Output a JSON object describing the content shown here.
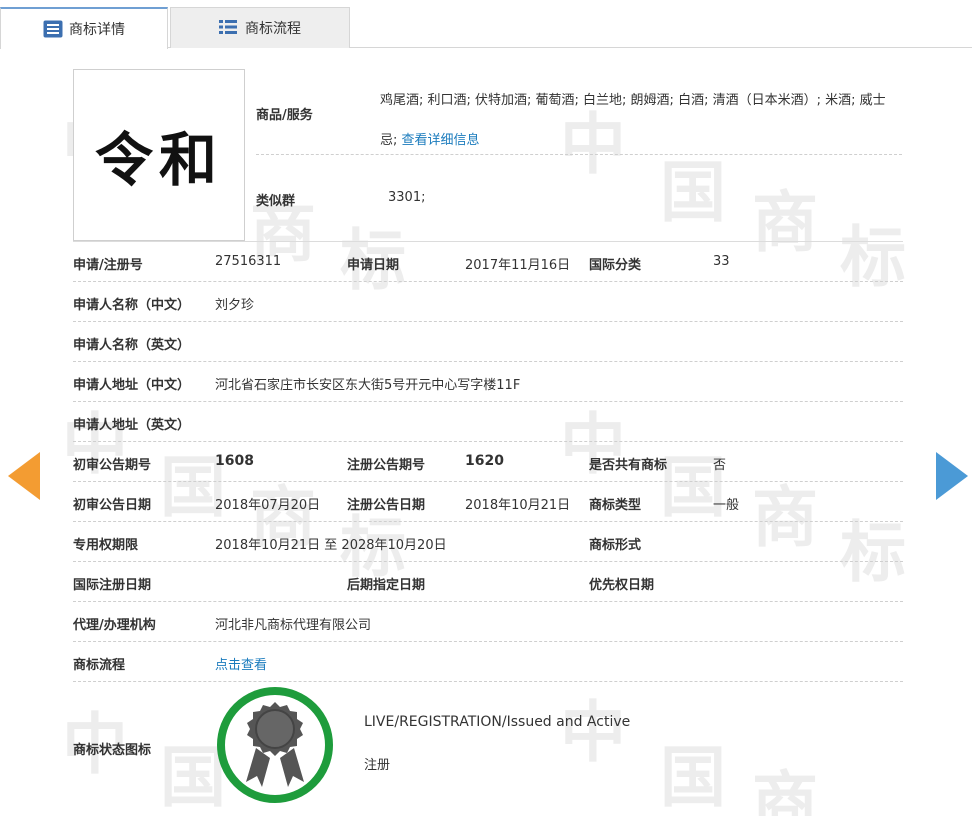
{
  "tabs": [
    {
      "label": "商标详情",
      "icon": "list-icon"
    },
    {
      "label": "商标流程",
      "icon": "grid-list-icon"
    }
  ],
  "watermark": {
    "chars": [
      "中",
      "国",
      "商",
      "标"
    ]
  },
  "logo": {
    "text": "令和"
  },
  "goods": {
    "label": "商品/服务",
    "text": "鸡尾酒; 利口酒; 伏特加酒; 葡萄酒; 白兰地; 朗姆酒; 白酒; 清酒（日本米酒）; 米酒; 威士忌;",
    "link": "查看详细信息"
  },
  "similar_group": {
    "label": "类似群",
    "value": "3301;"
  },
  "fields": {
    "reg_no": {
      "label": "申请/注册号",
      "value": "27516311"
    },
    "apply_date": {
      "label": "申请日期",
      "value": "2017年11月16日"
    },
    "intl_class": {
      "label": "国际分类",
      "value": "33"
    },
    "applicant_cn": {
      "label": "申请人名称（中文）",
      "value": "刘夕珍"
    },
    "applicant_en": {
      "label": "申请人名称（英文）",
      "value": ""
    },
    "address_cn": {
      "label": "申请人地址（中文）",
      "value": "河北省石家庄市长安区东大街5号开元中心写字楼11F"
    },
    "address_en": {
      "label": "申请人地址（英文）",
      "value": ""
    },
    "prelim_issue_no": {
      "label": "初审公告期号",
      "value": "1608"
    },
    "reg_issue_no": {
      "label": "注册公告期号",
      "value": "1620"
    },
    "shared": {
      "label": "是否共有商标",
      "value": "否"
    },
    "prelim_date": {
      "label": "初审公告日期",
      "value": "2018年07月20日"
    },
    "reg_date": {
      "label": "注册公告日期",
      "value": "2018年10月21日"
    },
    "tm_type": {
      "label": "商标类型",
      "value": "一般"
    },
    "exclusive_period": {
      "label": "专用权期限",
      "value": "2018年10月21日 至 2028年10月20日"
    },
    "tm_form": {
      "label": "商标形式",
      "value": ""
    },
    "intl_reg_date": {
      "label": "国际注册日期",
      "value": ""
    },
    "later_designation": {
      "label": "后期指定日期",
      "value": ""
    },
    "priority_date": {
      "label": "优先权日期",
      "value": ""
    },
    "agent": {
      "label": "代理/办理机构",
      "value": "河北非凡商标代理有限公司"
    },
    "process": {
      "label": "商标流程",
      "value": "点击查看"
    }
  },
  "status": {
    "label": "商标状态图标",
    "en": "LIVE/REGISTRATION/Issued and Active",
    "cn": "注册",
    "ring_color": "#1e9c3c",
    "medal_color": "#555555"
  },
  "nav": {
    "prev_color": "#f39c32",
    "next_color": "#4b9ad6"
  }
}
